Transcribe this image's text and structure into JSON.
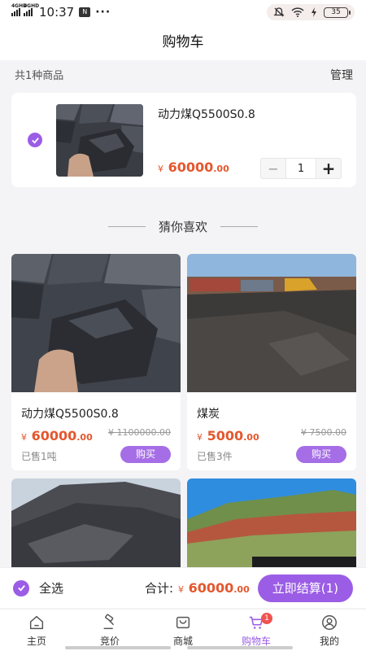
{
  "status": {
    "net1": "4GHD",
    "net2": "4GHD",
    "time": "10:37",
    "battery": "35",
    "nfc_label": "N",
    "menu_dots": "···"
  },
  "header": {
    "title": "购物车"
  },
  "cart": {
    "summary": "共1种商品",
    "manage": "管理",
    "items": [
      {
        "title": "动力煤Q5500S0.8",
        "currency": "¥",
        "price_int": "60000",
        "price_dec": ".00",
        "qty": "1",
        "minus": "−",
        "plus": "+"
      }
    ]
  },
  "recommend": {
    "title": "猜你喜欢",
    "products": [
      {
        "title": "动力煤Q5500S0.8",
        "currency": "¥",
        "price_int": "60000",
        "price_dec": ".00",
        "orig": "¥ 1100000.00",
        "sold": "已售1吨",
        "buy": "购买"
      },
      {
        "title": "煤炭",
        "currency": "¥",
        "price_int": "5000",
        "price_dec": ".00",
        "orig": "¥ 7500.00",
        "sold": "已售3件",
        "buy": "购买"
      }
    ]
  },
  "checkout": {
    "select_all": "全选",
    "total_label": "合计:",
    "currency": "¥",
    "total_int": "60000",
    "total_dec": ".00",
    "button": "立即结算(1)"
  },
  "tabs": [
    {
      "label": "主页",
      "icon": "home-icon"
    },
    {
      "label": "竞价",
      "icon": "auction-icon"
    },
    {
      "label": "商城",
      "icon": "mall-icon"
    },
    {
      "label": "购物车",
      "icon": "cart-icon",
      "active": true,
      "badge": "1"
    },
    {
      "label": "我的",
      "icon": "profile-icon"
    }
  ],
  "colors": {
    "accent": "#9b5de5",
    "price": "#e4572e",
    "buy_button": "#a66ee6",
    "badge": "#ef5350"
  }
}
